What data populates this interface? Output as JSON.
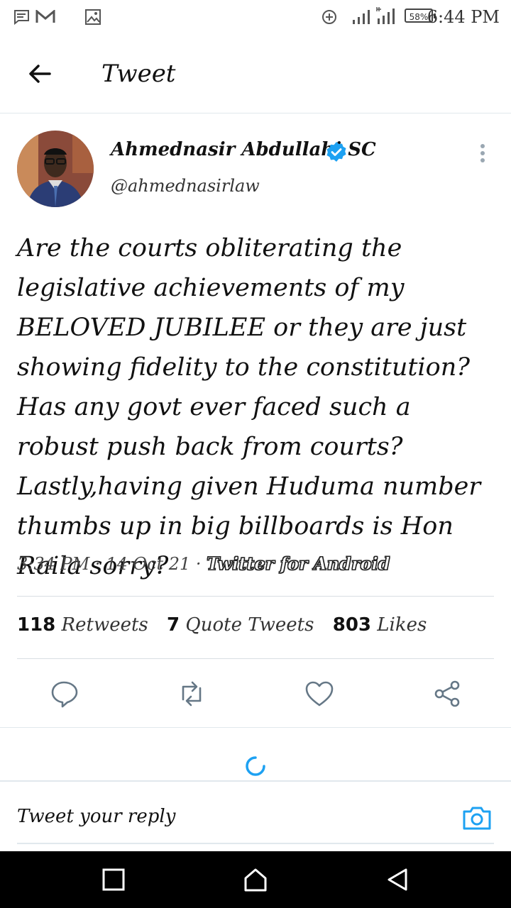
{
  "status_bar": {
    "battery": "58%",
    "time": "6:44 PM",
    "icons": [
      "message-icon",
      "gmail-icon",
      "image-icon",
      "data-saver-icon",
      "signal-icon",
      "signal-4g-icon"
    ]
  },
  "header": {
    "title": "Tweet"
  },
  "tweet": {
    "author_name": "Ahmednasir Abdullahi SC",
    "author_handle": "@ahmednasirlaw",
    "verified": true,
    "text": "Are the courts obliterating the legislative achievements of my BELOVED JUBILEE or they are just showing fidelity to the constitution? Has any govt ever faced such a robust push back from courts?Lastly,having given Huduma number thumbs up in big billboards is Hon Raila sorry?",
    "time": "3:34 PM",
    "date": "14 Oct 21",
    "source": "Twitter for Android",
    "separator": "·"
  },
  "stats": {
    "retweets_count": "118",
    "retweets_label": "Retweets",
    "quotes_count": "7",
    "quotes_label": "Quote Tweets",
    "likes_count": "803",
    "likes_label": "Likes"
  },
  "reply": {
    "placeholder": "Tweet your reply"
  },
  "colors": {
    "accent": "#1da1f2",
    "divider": "#e1e8ed",
    "icon_gray": "#657786"
  }
}
